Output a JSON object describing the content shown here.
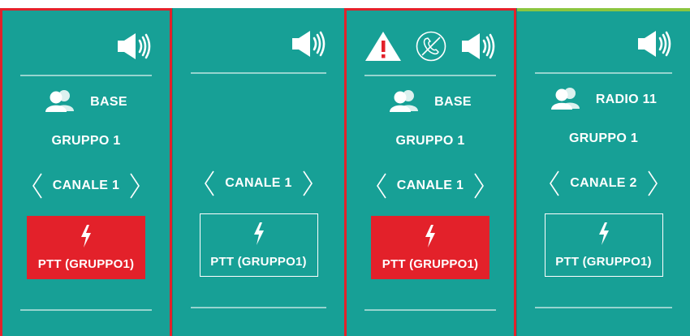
{
  "panels": [
    {
      "selected": true,
      "top_color": "",
      "icons": [
        "speaker-icon"
      ],
      "user": "BASE",
      "group": "GRUPPO 1",
      "channel": "CANALE 1",
      "ptt_label": "PTT (GRUPPO1)",
      "ptt_active": true
    },
    {
      "selected": false,
      "top_color": "",
      "icons": [
        "speaker-icon"
      ],
      "user": "",
      "group": "",
      "channel": "CANALE 1",
      "ptt_label": "PTT (GRUPPO1)",
      "ptt_active": false
    },
    {
      "selected": true,
      "top_color": "",
      "icons": [
        "warning-icon",
        "phone-off-icon",
        "speaker-icon"
      ],
      "user": "BASE",
      "group": "GRUPPO 1",
      "channel": "CANALE 1",
      "ptt_label": "PTT (GRUPPO1)",
      "ptt_active": true
    },
    {
      "selected": false,
      "top_color": "#8cc63f",
      "icons": [
        "speaker-icon"
      ],
      "user": "RADIO 11",
      "group": "GRUPPO 1",
      "channel": "CANALE 2",
      "ptt_label": "PTT (GRUPPO1)",
      "ptt_active": false
    }
  ],
  "colors": {
    "panel_bg": "#17a096",
    "selected_border": "#e3212a",
    "ptt_active": "#e3212a",
    "warning": "#e3212a",
    "text": "#ffffff"
  }
}
